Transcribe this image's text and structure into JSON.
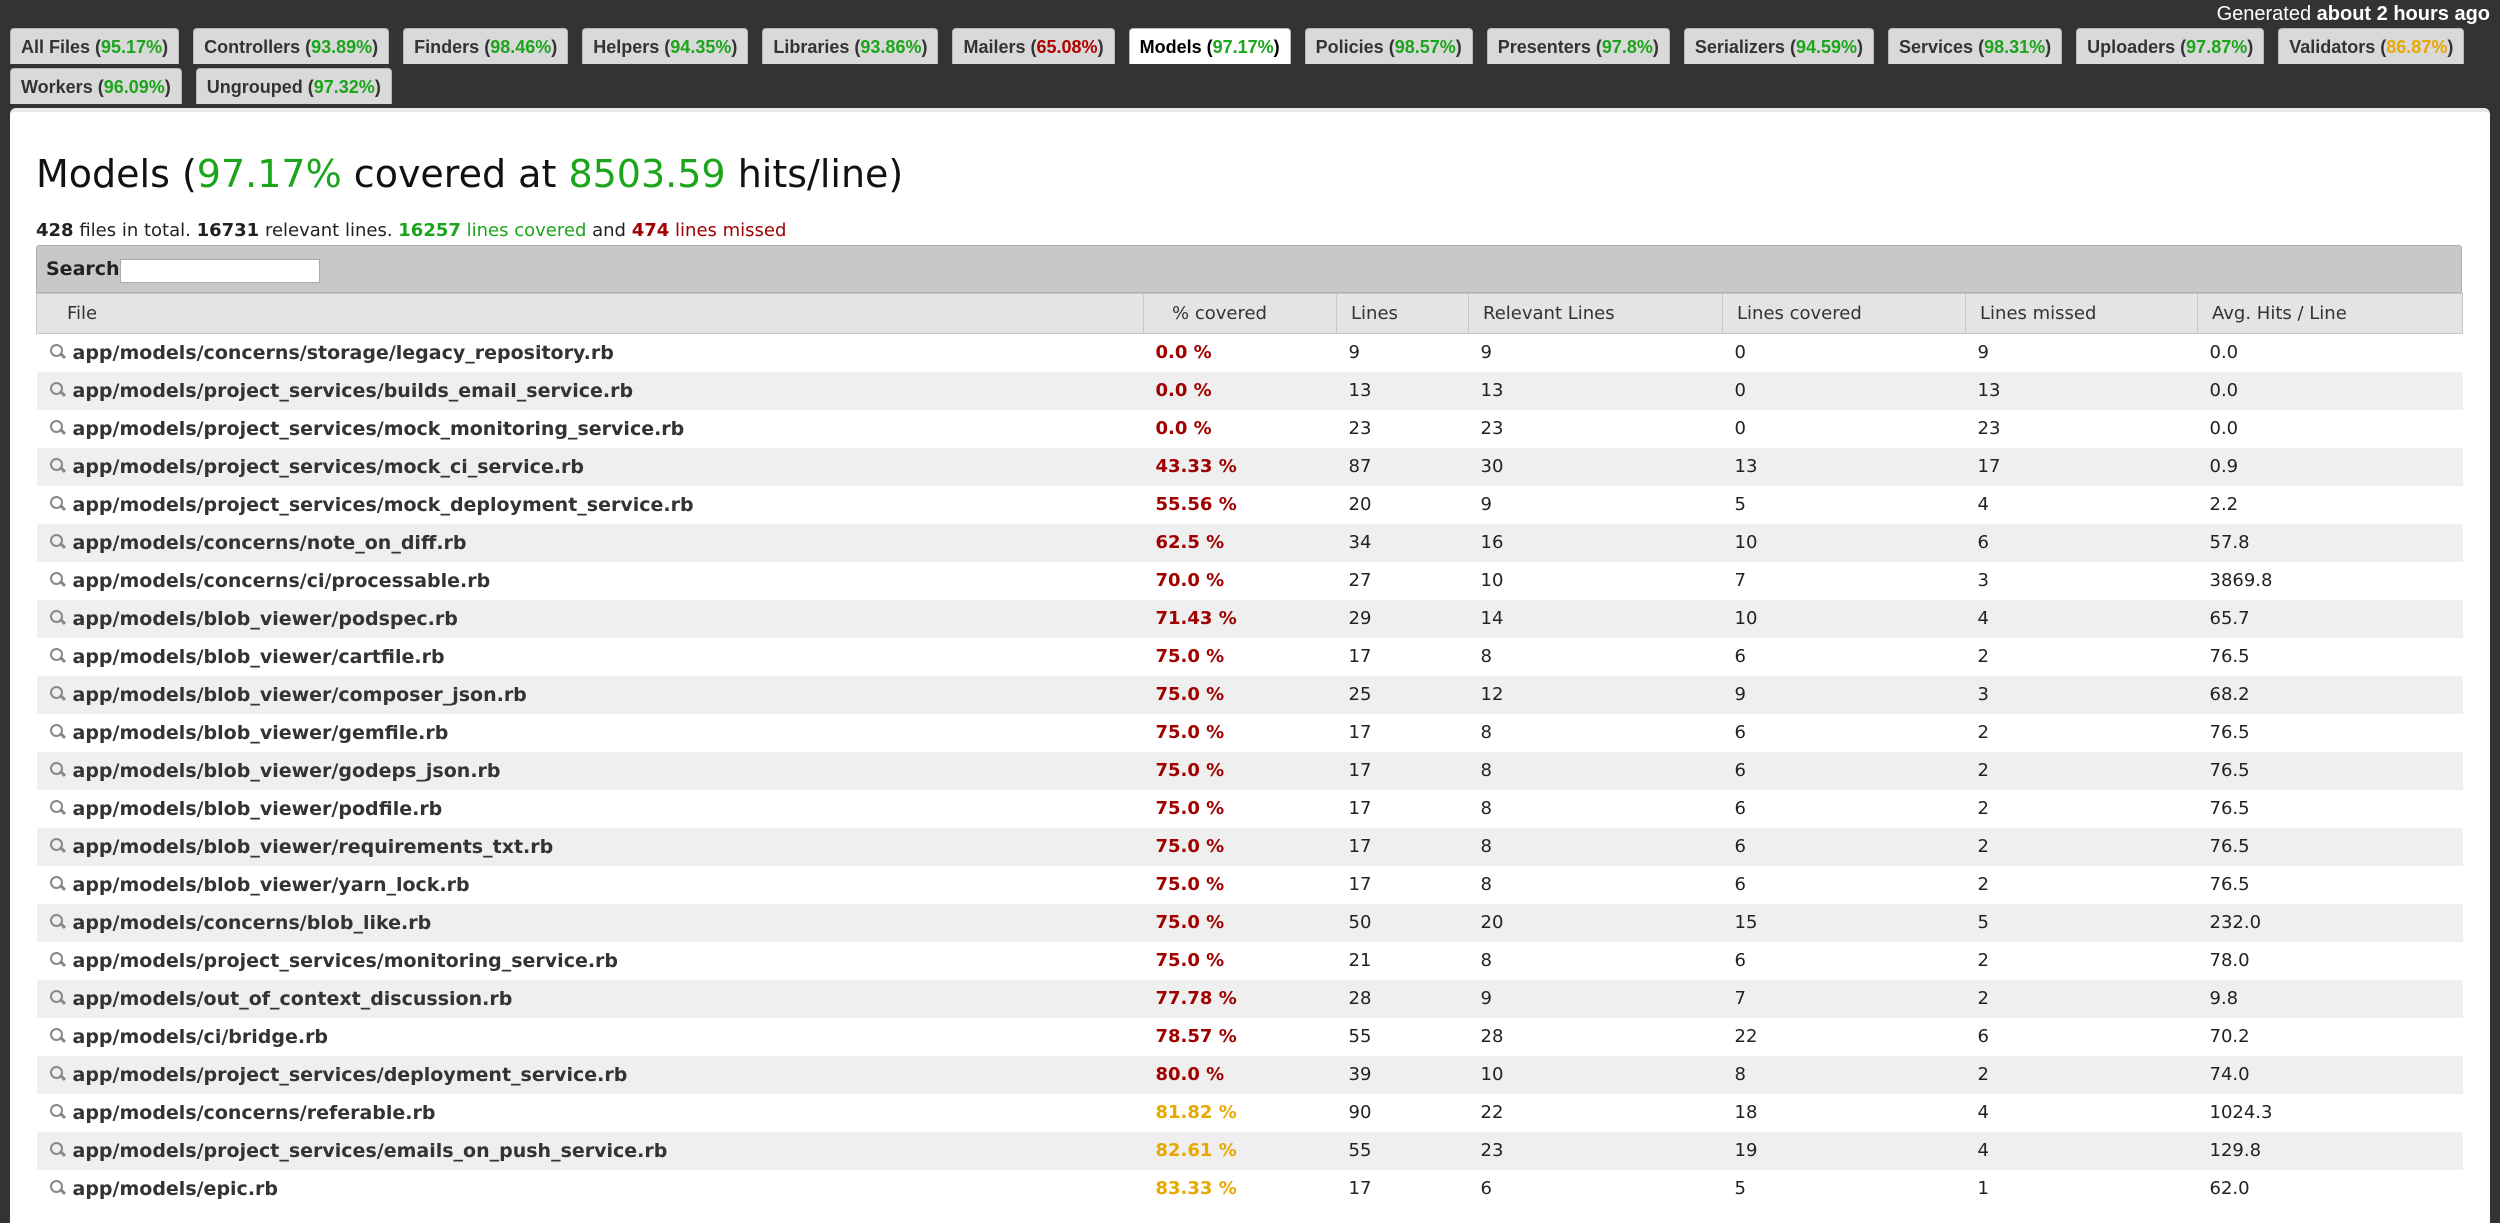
{
  "generated": {
    "prefix": "Generated ",
    "time": "about 2 hours ago"
  },
  "tabs": [
    {
      "label": "All Files",
      "pct": "95.17%",
      "color": "green"
    },
    {
      "label": "Controllers",
      "pct": "93.89%",
      "color": "green"
    },
    {
      "label": "Finders",
      "pct": "98.46%",
      "color": "green"
    },
    {
      "label": "Helpers",
      "pct": "94.35%",
      "color": "green"
    },
    {
      "label": "Libraries",
      "pct": "93.86%",
      "color": "green"
    },
    {
      "label": "Mailers",
      "pct": "65.08%",
      "color": "red"
    },
    {
      "label": "Models",
      "pct": "97.17%",
      "color": "green",
      "active": true
    },
    {
      "label": "Policies",
      "pct": "98.57%",
      "color": "green"
    },
    {
      "label": "Presenters",
      "pct": "97.8%",
      "color": "green"
    },
    {
      "label": "Serializers",
      "pct": "94.59%",
      "color": "green"
    },
    {
      "label": "Services",
      "pct": "98.31%",
      "color": "green"
    },
    {
      "label": "Uploaders",
      "pct": "97.87%",
      "color": "green"
    },
    {
      "label": "Validators",
      "pct": "86.87%",
      "color": "yellow"
    },
    {
      "label": "Workers",
      "pct": "96.09%",
      "color": "green"
    },
    {
      "label": "Ungrouped",
      "pct": "97.32%",
      "color": "green"
    }
  ],
  "title": {
    "name": "Models",
    "pct": "97.17%",
    "covered_at": "covered at",
    "hits": "8503.59",
    "unit": "hits/line)"
  },
  "summary": {
    "files": "428",
    "files_text": "files in total.",
    "relevant": "16731",
    "relevant_text": "relevant lines.",
    "covered": "16257",
    "covered_text": "lines covered",
    "and_text": "and",
    "missed": "474",
    "missed_text": "lines missed"
  },
  "search": {
    "label": "Search:",
    "value": ""
  },
  "columns": [
    "File",
    "% covered",
    "Lines",
    "Relevant Lines",
    "Lines covered",
    "Lines missed",
    "Avg. Hits / Line"
  ],
  "rows": [
    [
      "app/models/concerns/storage/legacy_repository.rb",
      "0.0 %",
      "9",
      "9",
      "0",
      "9",
      "0.0"
    ],
    [
      "app/models/project_services/builds_email_service.rb",
      "0.0 %",
      "13",
      "13",
      "0",
      "13",
      "0.0"
    ],
    [
      "app/models/project_services/mock_monitoring_service.rb",
      "0.0 %",
      "23",
      "23",
      "0",
      "23",
      "0.0"
    ],
    [
      "app/models/project_services/mock_ci_service.rb",
      "43.33 %",
      "87",
      "30",
      "13",
      "17",
      "0.9"
    ],
    [
      "app/models/project_services/mock_deployment_service.rb",
      "55.56 %",
      "20",
      "9",
      "5",
      "4",
      "2.2"
    ],
    [
      "app/models/concerns/note_on_diff.rb",
      "62.5 %",
      "34",
      "16",
      "10",
      "6",
      "57.8"
    ],
    [
      "app/models/concerns/ci/processable.rb",
      "70.0 %",
      "27",
      "10",
      "7",
      "3",
      "3869.8"
    ],
    [
      "app/models/blob_viewer/podspec.rb",
      "71.43 %",
      "29",
      "14",
      "10",
      "4",
      "65.7"
    ],
    [
      "app/models/blob_viewer/cartfile.rb",
      "75.0 %",
      "17",
      "8",
      "6",
      "2",
      "76.5"
    ],
    [
      "app/models/blob_viewer/composer_json.rb",
      "75.0 %",
      "25",
      "12",
      "9",
      "3",
      "68.2"
    ],
    [
      "app/models/blob_viewer/gemfile.rb",
      "75.0 %",
      "17",
      "8",
      "6",
      "2",
      "76.5"
    ],
    [
      "app/models/blob_viewer/godeps_json.rb",
      "75.0 %",
      "17",
      "8",
      "6",
      "2",
      "76.5"
    ],
    [
      "app/models/blob_viewer/podfile.rb",
      "75.0 %",
      "17",
      "8",
      "6",
      "2",
      "76.5"
    ],
    [
      "app/models/blob_viewer/requirements_txt.rb",
      "75.0 %",
      "17",
      "8",
      "6",
      "2",
      "76.5"
    ],
    [
      "app/models/blob_viewer/yarn_lock.rb",
      "75.0 %",
      "17",
      "8",
      "6",
      "2",
      "76.5"
    ],
    [
      "app/models/concerns/blob_like.rb",
      "75.0 %",
      "50",
      "20",
      "15",
      "5",
      "232.0"
    ],
    [
      "app/models/project_services/monitoring_service.rb",
      "75.0 %",
      "21",
      "8",
      "6",
      "2",
      "78.0"
    ],
    [
      "app/models/out_of_context_discussion.rb",
      "77.78 %",
      "28",
      "9",
      "7",
      "2",
      "9.8"
    ],
    [
      "app/models/ci/bridge.rb",
      "78.57 %",
      "55",
      "28",
      "22",
      "6",
      "70.2"
    ],
    [
      "app/models/project_services/deployment_service.rb",
      "80.0 %",
      "39",
      "10",
      "8",
      "2",
      "74.0"
    ],
    [
      "app/models/concerns/referable.rb",
      "81.82 %",
      "90",
      "22",
      "18",
      "4",
      "1024.3"
    ],
    [
      "app/models/project_services/emails_on_push_service.rb",
      "82.61 %",
      "55",
      "23",
      "19",
      "4",
      "129.8"
    ],
    [
      "app/models/epic.rb",
      "83.33 %",
      "17",
      "6",
      "5",
      "1",
      "62.0"
    ]
  ],
  "colors": {
    "green": "#1aa51a",
    "red": "#a00000",
    "yellow": "#e8a800",
    "chrome": "#333333"
  }
}
